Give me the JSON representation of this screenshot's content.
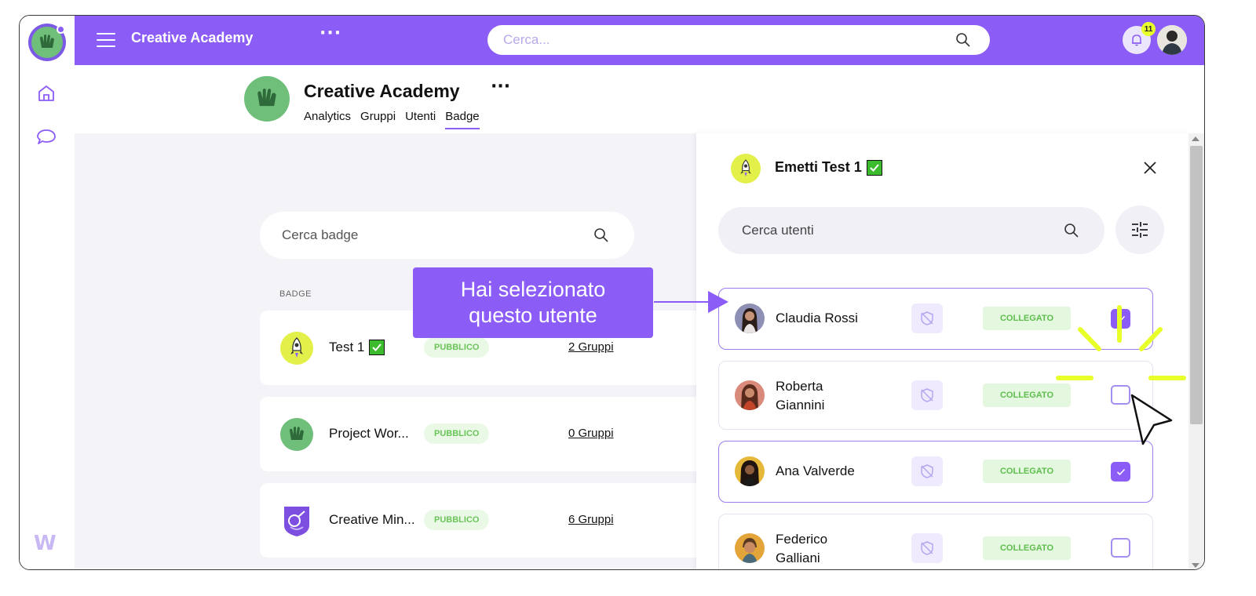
{
  "app": {
    "title": "Creative Academy"
  },
  "topbar": {
    "more_label": "···",
    "search_placeholder": "Cerca...",
    "notifications_count": "11"
  },
  "org": {
    "name": "Creative Academy",
    "more_label": "···",
    "tabs": [
      {
        "label": "Analytics",
        "active": false
      },
      {
        "label": "Gruppi",
        "active": false
      },
      {
        "label": "Utenti",
        "active": false
      },
      {
        "label": "Badge",
        "active": true
      }
    ]
  },
  "badges": {
    "search_placeholder": "Cerca badge",
    "column_header": "BADGE",
    "rows": [
      {
        "name": "Test 1",
        "has_check": true,
        "visibility": "PUBBLICO",
        "groups": "2 Gruppi",
        "icon": "rocket-icon"
      },
      {
        "name": "Project Wor...",
        "has_check": false,
        "visibility": "PUBBLICO",
        "groups": "0 Gruppi",
        "icon": "hands-icon"
      },
      {
        "name": "Creative Min...",
        "has_check": false,
        "visibility": "PUBBLICO",
        "groups": "6 Gruppi",
        "icon": "shield-badge-icon"
      }
    ]
  },
  "panel": {
    "title": "Emetti Test 1",
    "search_placeholder": "Cerca utenti",
    "users": [
      {
        "name_line1": "Claudia Rossi",
        "name_line2": "",
        "status": "COLLEGATO",
        "checked": true,
        "selected": true
      },
      {
        "name_line1": "Roberta",
        "name_line2": "Giannini",
        "status": "COLLEGATO",
        "checked": false,
        "selected": false
      },
      {
        "name_line1": "Ana Valverde",
        "name_line2": "",
        "status": "COLLEGATO",
        "checked": true,
        "selected": true
      },
      {
        "name_line1": "Federico",
        "name_line2": "Galliani",
        "status": "COLLEGATO",
        "checked": false,
        "selected": false
      }
    ]
  },
  "callout": {
    "line1": "Hai selezionato",
    "line2": "questo utente"
  },
  "colors": {
    "accent": "#8b5cf6",
    "public_pill_bg": "#eaf9e6",
    "public_pill_text": "#6bc45a",
    "status_bg": "#e3f8de",
    "highlight_rays": "#e8ff2a"
  }
}
